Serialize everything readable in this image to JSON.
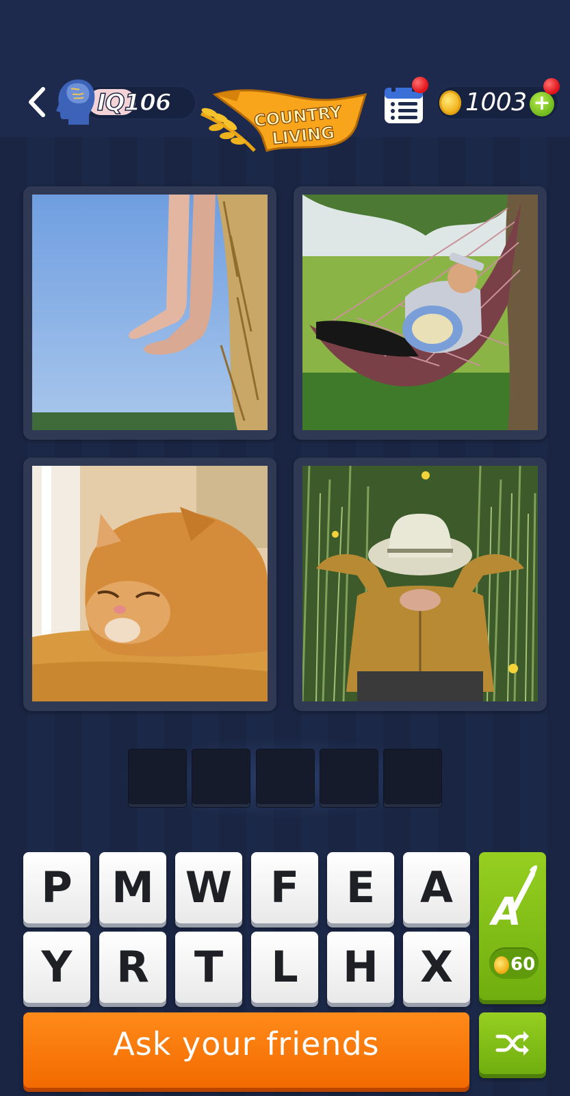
{
  "header": {
    "iq_label": "IQ",
    "iq_value": "106",
    "level_theme_line1": "COUNTRY",
    "level_theme_line2": "LIVING",
    "coins": "1003",
    "plus_label": "+"
  },
  "icons": {
    "back": "chevron-left-icon",
    "brain": "brain-head-icon",
    "calendar": "daily-calendar-icon",
    "coin": "coin-icon",
    "plus": "plus-icon",
    "hint": "letter-brush-icon",
    "shuffle": "shuffle-icon"
  },
  "pictures": [
    {
      "subject": "bare feet dangling over hay bale"
    },
    {
      "subject": "man sleeping in hammock"
    },
    {
      "subject": "sleepy orange cat"
    },
    {
      "subject": "person resting in grass with hat over face"
    }
  ],
  "answer": {
    "slot_count": 5,
    "letters": [
      "",
      "",
      "",
      "",
      ""
    ]
  },
  "letters": [
    "P",
    "M",
    "W",
    "F",
    "E",
    "A",
    "Y",
    "R",
    "T",
    "L",
    "H",
    "X"
  ],
  "hint": {
    "cost": "60"
  },
  "ask_button": "Ask your friends",
  "colors": {
    "background": "#18223f",
    "header": "#1d2a4d",
    "ask_orange": "#f26a00",
    "hint_green": "#7fbd14",
    "notification_red": "#e0141a"
  }
}
